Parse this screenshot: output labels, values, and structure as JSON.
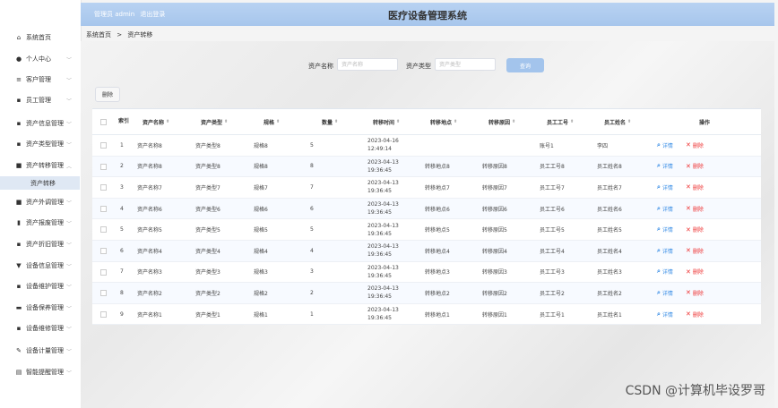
{
  "header": {
    "admin_label": "管理员 admin",
    "logout_label": "退出登录",
    "app_title": "医疗设备管理系统"
  },
  "breadcrumb": {
    "home": "系统首页",
    "sep": ">",
    "current": "资产转移"
  },
  "sidebar": {
    "items": [
      {
        "label": "系统首页",
        "icon": "home-icon"
      },
      {
        "label": "个人中心",
        "icon": "user-icon"
      },
      {
        "label": "客户管理",
        "icon": "list-icon"
      },
      {
        "label": "员工管理",
        "icon": "grid-icon"
      },
      {
        "label": "资产信息管理",
        "icon": "grid-icon"
      },
      {
        "label": "资产类型管理",
        "icon": "grid-icon"
      },
      {
        "label": "资产转移管理",
        "icon": "check-icon"
      },
      {
        "label": "资产外调管理",
        "icon": "check-icon"
      },
      {
        "label": "资产报废管理",
        "icon": "trash-icon"
      },
      {
        "label": "资产折旧管理",
        "icon": "grid-icon"
      },
      {
        "label": "设备信息管理",
        "icon": "filter-icon"
      },
      {
        "label": "设备维护管理",
        "icon": "grid-icon"
      },
      {
        "label": "设备保养管理",
        "icon": "monitor-icon"
      },
      {
        "label": "设备维修管理",
        "icon": "grid-icon"
      },
      {
        "label": "设备计量管理",
        "icon": "edit-icon"
      },
      {
        "label": "智能提醒管理",
        "icon": "book-icon"
      }
    ],
    "sub_active": "资产转移"
  },
  "search": {
    "asset_name_label": "资产名称",
    "asset_name_placeholder": "资产名称",
    "asset_type_label": "资产类型",
    "asset_type_placeholder": "资产类型",
    "query_button": "查询"
  },
  "toolbar": {
    "delete_button": "删除"
  },
  "table": {
    "headers": [
      "索引",
      "资产名称",
      "资产类型",
      "规格",
      "数量",
      "转移时间",
      "转移地点",
      "转移原因",
      "员工工号",
      "员工姓名",
      "操作"
    ],
    "detail_label": "详情",
    "delete_label": "删除",
    "rows": [
      {
        "index": "1",
        "name": "资产名称8",
        "type": "资产类型8",
        "spec": "规格8",
        "qty": "5",
        "time": "2023-04-16 12:49:14",
        "place": "",
        "reason": "",
        "emp_no": "账号1",
        "emp_name": "李四"
      },
      {
        "index": "2",
        "name": "资产名称8",
        "type": "资产类型8",
        "spec": "规格8",
        "qty": "8",
        "time": "2023-04-13 19:36:45",
        "place": "转移地点8",
        "reason": "转移原因8",
        "emp_no": "员工工号8",
        "emp_name": "员工姓名8"
      },
      {
        "index": "3",
        "name": "资产名称7",
        "type": "资产类型7",
        "spec": "规格7",
        "qty": "7",
        "time": "2023-04-13 19:36:45",
        "place": "转移地点7",
        "reason": "转移原因7",
        "emp_no": "员工工号7",
        "emp_name": "员工姓名7"
      },
      {
        "index": "4",
        "name": "资产名称6",
        "type": "资产类型6",
        "spec": "规格6",
        "qty": "6",
        "time": "2023-04-13 19:36:45",
        "place": "转移地点6",
        "reason": "转移原因6",
        "emp_no": "员工工号6",
        "emp_name": "员工姓名6"
      },
      {
        "index": "5",
        "name": "资产名称5",
        "type": "资产类型5",
        "spec": "规格5",
        "qty": "5",
        "time": "2023-04-13 19:36:45",
        "place": "转移地点5",
        "reason": "转移原因5",
        "emp_no": "员工工号5",
        "emp_name": "员工姓名5"
      },
      {
        "index": "6",
        "name": "资产名称4",
        "type": "资产类型4",
        "spec": "规格4",
        "qty": "4",
        "time": "2023-04-13 19:36:45",
        "place": "转移地点4",
        "reason": "转移原因4",
        "emp_no": "员工工号4",
        "emp_name": "员工姓名4"
      },
      {
        "index": "7",
        "name": "资产名称3",
        "type": "资产类型3",
        "spec": "规格3",
        "qty": "3",
        "time": "2023-04-13 19:36:45",
        "place": "转移地点3",
        "reason": "转移原因3",
        "emp_no": "员工工号3",
        "emp_name": "员工姓名3"
      },
      {
        "index": "8",
        "name": "资产名称2",
        "type": "资产类型2",
        "spec": "规格2",
        "qty": "2",
        "time": "2023-04-13 19:36:45",
        "place": "转移地点2",
        "reason": "转移原因2",
        "emp_no": "员工工号2",
        "emp_name": "员工姓名2"
      },
      {
        "index": "9",
        "name": "资产名称1",
        "type": "资产类型1",
        "spec": "规格1",
        "qty": "1",
        "time": "2023-04-13 19:36:45",
        "place": "转移地点1",
        "reason": "转移原因1",
        "emp_no": "员工工号1",
        "emp_name": "员工姓名1"
      }
    ]
  },
  "watermark": "CSDN @计算机毕设罗哥",
  "colors": {
    "header": "#a7c6ec",
    "link": "#3a8ee6",
    "danger": "#e33333"
  }
}
